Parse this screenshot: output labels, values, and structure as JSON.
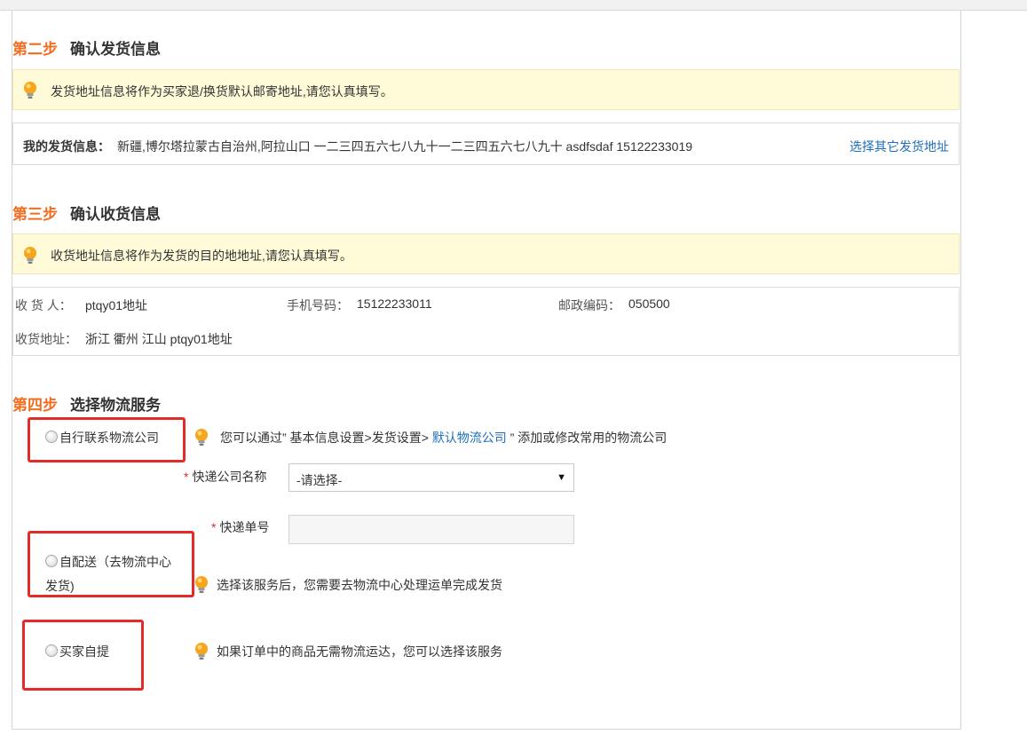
{
  "step2": {
    "num": "第二步",
    "title": "确认发货信息",
    "notice": "发货地址信息将作为买家退/换货默认邮寄地址,请您认真填写。",
    "sender_label": "我的发货信息：",
    "sender_info": "新疆,博尔塔拉蒙古自治州,阿拉山口  一二三四五六七八九十一二三四五六七八九十  asdfsdaf  15122233019",
    "change_link": "选择其它发货地址"
  },
  "step3": {
    "num": "第三步",
    "title": "确认收货信息",
    "notice": "收货地址信息将作为发货的目的地地址,请您认真填写。",
    "receiver_label": "收 货 人：",
    "receiver_value": "ptqy01地址",
    "phone_label": "手机号码：",
    "phone_value": "15122233011",
    "zip_label": "邮政编码：",
    "zip_value": "050500",
    "address_label": "收货地址：",
    "address_value": "浙江 衢州 江山   ptqy01地址"
  },
  "step4": {
    "num": "第四步",
    "title": "选择物流服务",
    "option1": "自行联系物流公司",
    "option1_hint_pre": "您可以通过” 基本信息设置>发货设置> ",
    "option1_hint_link": "默认物流公司",
    "option1_hint_post": " ” 添加或修改常用的物流公司",
    "company_label": "快递公司名称",
    "company_select": "-请选择-",
    "tracking_label": "快递单号",
    "tracking_value": "",
    "option2_line1": "自配送（去物流中心",
    "option2_line2": "发货)",
    "option2_hint": "选择该服务后，您需要去物流中心处理运单完成发货",
    "option3": "买家自提",
    "option3_hint": "如果订单中的商品无需物流运达，您可以选择该服务",
    "required_mark": "*"
  },
  "colors": {
    "step_num": "#f26d1f",
    "link": "#1e6fb8",
    "notice_bg": "#fffbd9",
    "highlight": "#e52a2a"
  },
  "icons": {
    "tip": "lightbulb-icon",
    "radio": "radio-unchecked-icon"
  }
}
